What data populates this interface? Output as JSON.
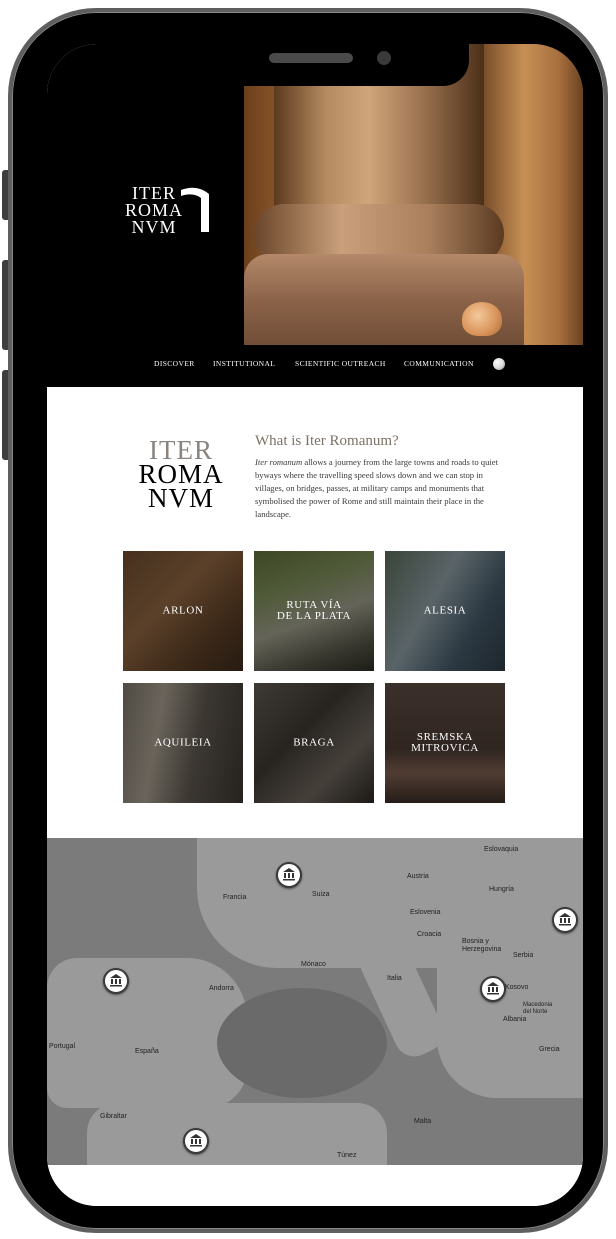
{
  "hero": {
    "logo_lines": [
      "ITER",
      "ROMA",
      "NVM"
    ],
    "nav": [
      "DISCOVER",
      "INSTITUTIONAL",
      "SCIENTIFIC OUTREACH",
      "COMMUNICATION"
    ],
    "globe_icon": "globe-icon"
  },
  "intro": {
    "logo_lines": [
      "ITER",
      "ROMA",
      "NVM"
    ],
    "title": "What is Iter Romanum?",
    "text_em": "Iter romanum",
    "text_rest": " allows a journey from the large towns and roads to quiet byways where the travelling speed slows down and we can stop in villages, on bridges, passes, at military camps and monuments that symbolised the power of Rome and still maintain their place in the landscape."
  },
  "tiles": [
    {
      "label": "ARLON"
    },
    {
      "label": "RUTA VÍA\nDE LA PLATA"
    },
    {
      "label": "ALESIA"
    },
    {
      "label": "AQUILEIA"
    },
    {
      "label": "BRAGA"
    },
    {
      "label": "SREMSKA\nMITROVICA"
    }
  ],
  "map": {
    "labels": [
      "Eslovaquia",
      "Francia",
      "Suiza",
      "Austria",
      "Hungría",
      "Eslovenia",
      "Croacia",
      "Bosnia y\nHerzegovina",
      "Serbia",
      "Mónaco",
      "Andorra",
      "Italia",
      "Kosovo",
      "Macedonia\ndel Norte",
      "Albania",
      "Portugal",
      "España",
      "Grecia",
      "Gibraltar",
      "Malta",
      "Túnez"
    ],
    "marker_icon": "temple-icon"
  }
}
